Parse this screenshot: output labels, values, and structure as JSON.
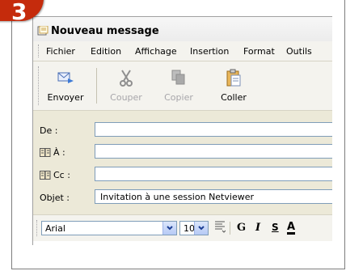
{
  "step": {
    "number": "3"
  },
  "window": {
    "title": "Nouveau message"
  },
  "menu": [
    "Fichier",
    "Edition",
    "Affichage",
    "Insertion",
    "Format",
    "Outils"
  ],
  "toolbar": {
    "send": "Envoyer",
    "cut": "Couper",
    "copy": "Copier",
    "paste": "Coller"
  },
  "fields": {
    "from_label": "De :",
    "to_label": "À :",
    "cc_label": "Cc :",
    "subject_label": "Objet :",
    "subject_value": "Invitation à une session Netviewer"
  },
  "format": {
    "font": "Arial",
    "size": "10",
    "bold": "G",
    "italic": "I",
    "strike": "S",
    "color": "A"
  },
  "colors": {
    "badge": "#c52b0c",
    "window_bg": "#ece9d8"
  }
}
